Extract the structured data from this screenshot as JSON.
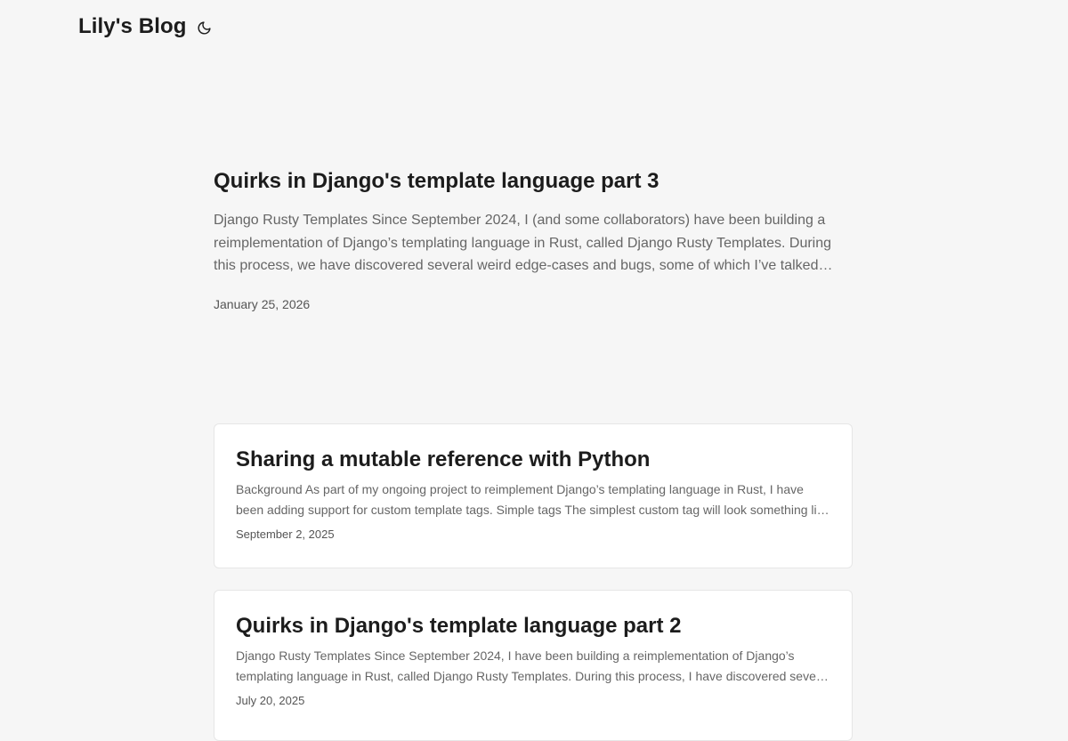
{
  "header": {
    "site_title": "Lily's Blog",
    "theme_toggle_icon": "moon-icon"
  },
  "featured": {
    "title": "Quirks in Django's template language part 3",
    "excerpt": "Django Rusty Templates Since September 2024, I (and some collaborators) have been building a reimplementation of Django’s templating language in Rust, called Django Rusty Templates. During this process, we have discovered several weird edge-cases and bugs, some of which I’ve talked about before.",
    "date": "January 25, 2026"
  },
  "posts": [
    {
      "title": "Sharing a mutable reference with Python",
      "excerpt": "Background As part of my ongoing project to reimplement Django’s templating language in Rust, I have been adding support for custom template tags. Simple tags The simplest custom tag will look something like this.",
      "date": "September 2, 2025"
    },
    {
      "title": "Quirks in Django's template language part 2",
      "excerpt": "Django Rusty Templates Since September 2024, I have been building a reimplementation of Django’s templating language in Rust, called Django Rusty Templates. During this process, I have discovered several weird edge-cases and bugs.",
      "date": "July 20, 2025"
    }
  ]
}
